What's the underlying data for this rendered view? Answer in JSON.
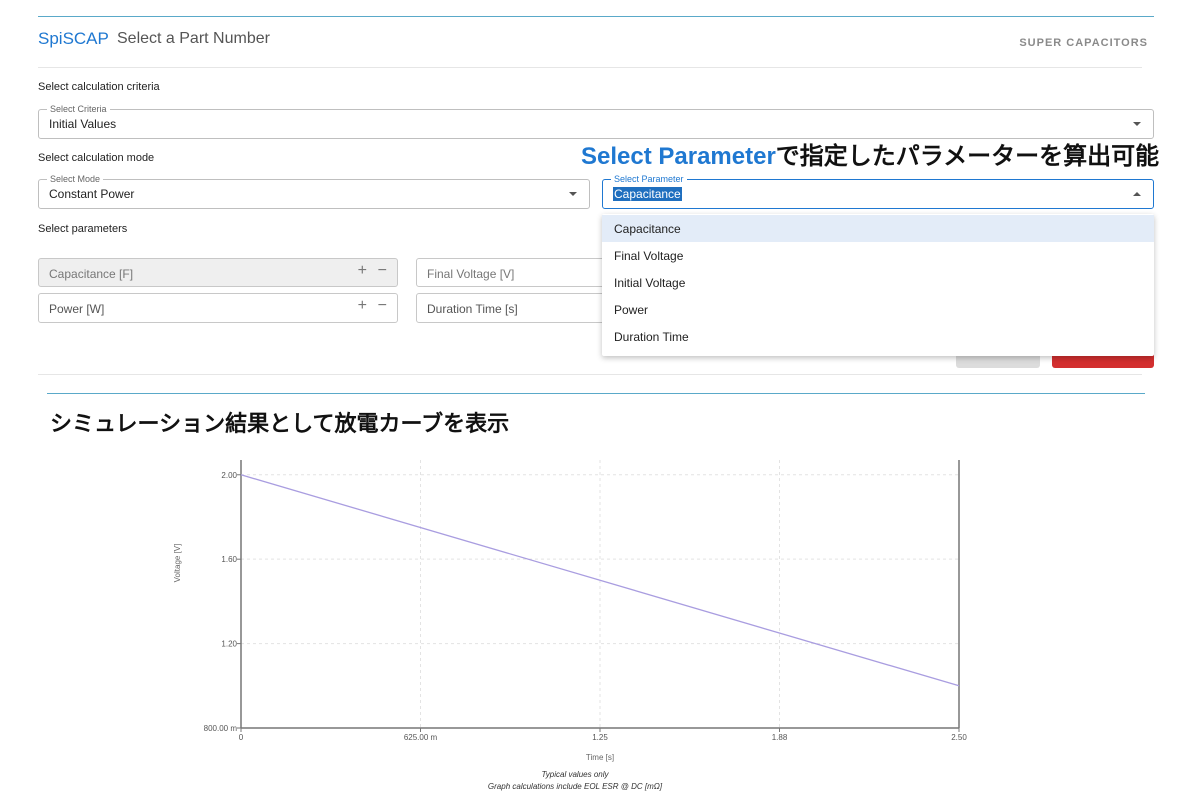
{
  "header": {
    "brand": "SpiSCAP",
    "subtitle": "Select a Part Number",
    "category": "SUPER CAPACITORS"
  },
  "criteria": {
    "section_label": "Select calculation criteria",
    "field_label": "Select Criteria",
    "value": "Initial Values"
  },
  "mode": {
    "section_label": "Select calculation mode",
    "field_label": "Select Mode",
    "value": "Constant Power"
  },
  "parameter": {
    "field_label": "Select Parameter",
    "value": "Capacitance",
    "options": [
      "Capacitance",
      "Final Voltage",
      "Initial Voltage",
      "Power",
      "Duration Time"
    ]
  },
  "parameters_section": {
    "label": "Select parameters",
    "fields": [
      {
        "placeholder": "Capacitance [F]",
        "disabled": true
      },
      {
        "placeholder": "Final Voltage [V]"
      },
      {
        "placeholder": "Power [W]"
      },
      {
        "placeholder": "Duration Time [s]"
      }
    ],
    "plus": "+",
    "minus": "−"
  },
  "annotations": {
    "param_highlight": "Select Parameter",
    "param_note": "で指定したパラメーターを算出可能",
    "result_note": "シミュレーション結果として放電カーブを表示"
  },
  "chart_data": {
    "type": "line",
    "xlabel": "Time [s]",
    "ylabel": "Voltage [V]",
    "x_ticks": [
      "0",
      "625.00 m",
      "1.25",
      "1.88",
      "2.50"
    ],
    "y_ticks": [
      "800.00 m",
      "1.20",
      "1.60",
      "2.00"
    ],
    "xlim": [
      0,
      2.5
    ],
    "ylim": [
      0.8,
      2.07
    ],
    "grid": true,
    "series": [
      {
        "x": [
          0,
          2.5
        ],
        "y": [
          2.0,
          1.0
        ],
        "color": "#a99de0"
      }
    ],
    "footnotes": [
      "Typical values only",
      "Graph calculations include EOL ESR @ DC [mΩ]"
    ]
  }
}
